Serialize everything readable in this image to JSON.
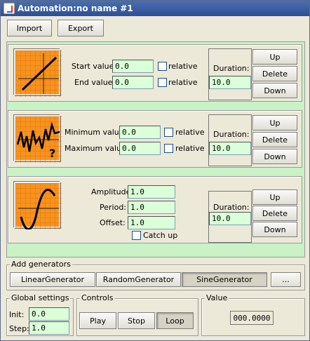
{
  "window": {
    "title": "Automation:no name #1"
  },
  "toolbar": {
    "import_label": "Import",
    "export_label": "Export"
  },
  "generators": [
    {
      "type": "linear",
      "icon": "linear-graph-icon",
      "fields": [
        {
          "label": "Start value:",
          "value": "0.0",
          "relative_label": "relative"
        },
        {
          "label": "End value:",
          "value": "0.0",
          "relative_label": "relative"
        }
      ],
      "duration_label": "Duration:",
      "duration_value": "10.0",
      "up_label": "Up",
      "delete_label": "Delete",
      "down_label": "Down"
    },
    {
      "type": "random",
      "icon": "random-graph-icon",
      "fields": [
        {
          "label": "Minimum value:",
          "value": "0.0",
          "relative_label": "relative"
        },
        {
          "label": "Maximum value:",
          "value": "0.0",
          "relative_label": "relative"
        }
      ],
      "duration_label": "Duration:",
      "duration_value": "10.0",
      "up_label": "Up",
      "delete_label": "Delete",
      "down_label": "Down"
    },
    {
      "type": "sine",
      "icon": "sine-graph-icon",
      "fields": [
        {
          "label": "Amplitude:",
          "value": "1.0"
        },
        {
          "label": "Period:",
          "value": "1.0"
        },
        {
          "label": "Offset:",
          "value": "1.0"
        }
      ],
      "catchup_label": "Catch up",
      "duration_label": "Duration:",
      "duration_value": "10.0",
      "up_label": "Up",
      "delete_label": "Delete",
      "down_label": "Down"
    }
  ],
  "add_generators": {
    "title": "Add generators",
    "buttons": [
      "LinearGenerator",
      "RandomGenerator",
      "SineGenerator",
      "..."
    ],
    "selected": "SineGenerator"
  },
  "global_settings": {
    "title": "Global settings",
    "init_label": "Init:",
    "init_value": "0.0",
    "step_label": "Step:",
    "step_value": "1.0"
  },
  "controls": {
    "title": "Controls",
    "play_label": "Play",
    "stop_label": "Stop",
    "loop_label": "Loop",
    "active": "Loop"
  },
  "value": {
    "title": "Value",
    "display": "000.0000"
  },
  "colors": {
    "title_bar": "#2c4f96",
    "panel_bg": "#c9f2c6",
    "field_bg": "#dbffd8",
    "icon_orange": "#f7931e"
  }
}
